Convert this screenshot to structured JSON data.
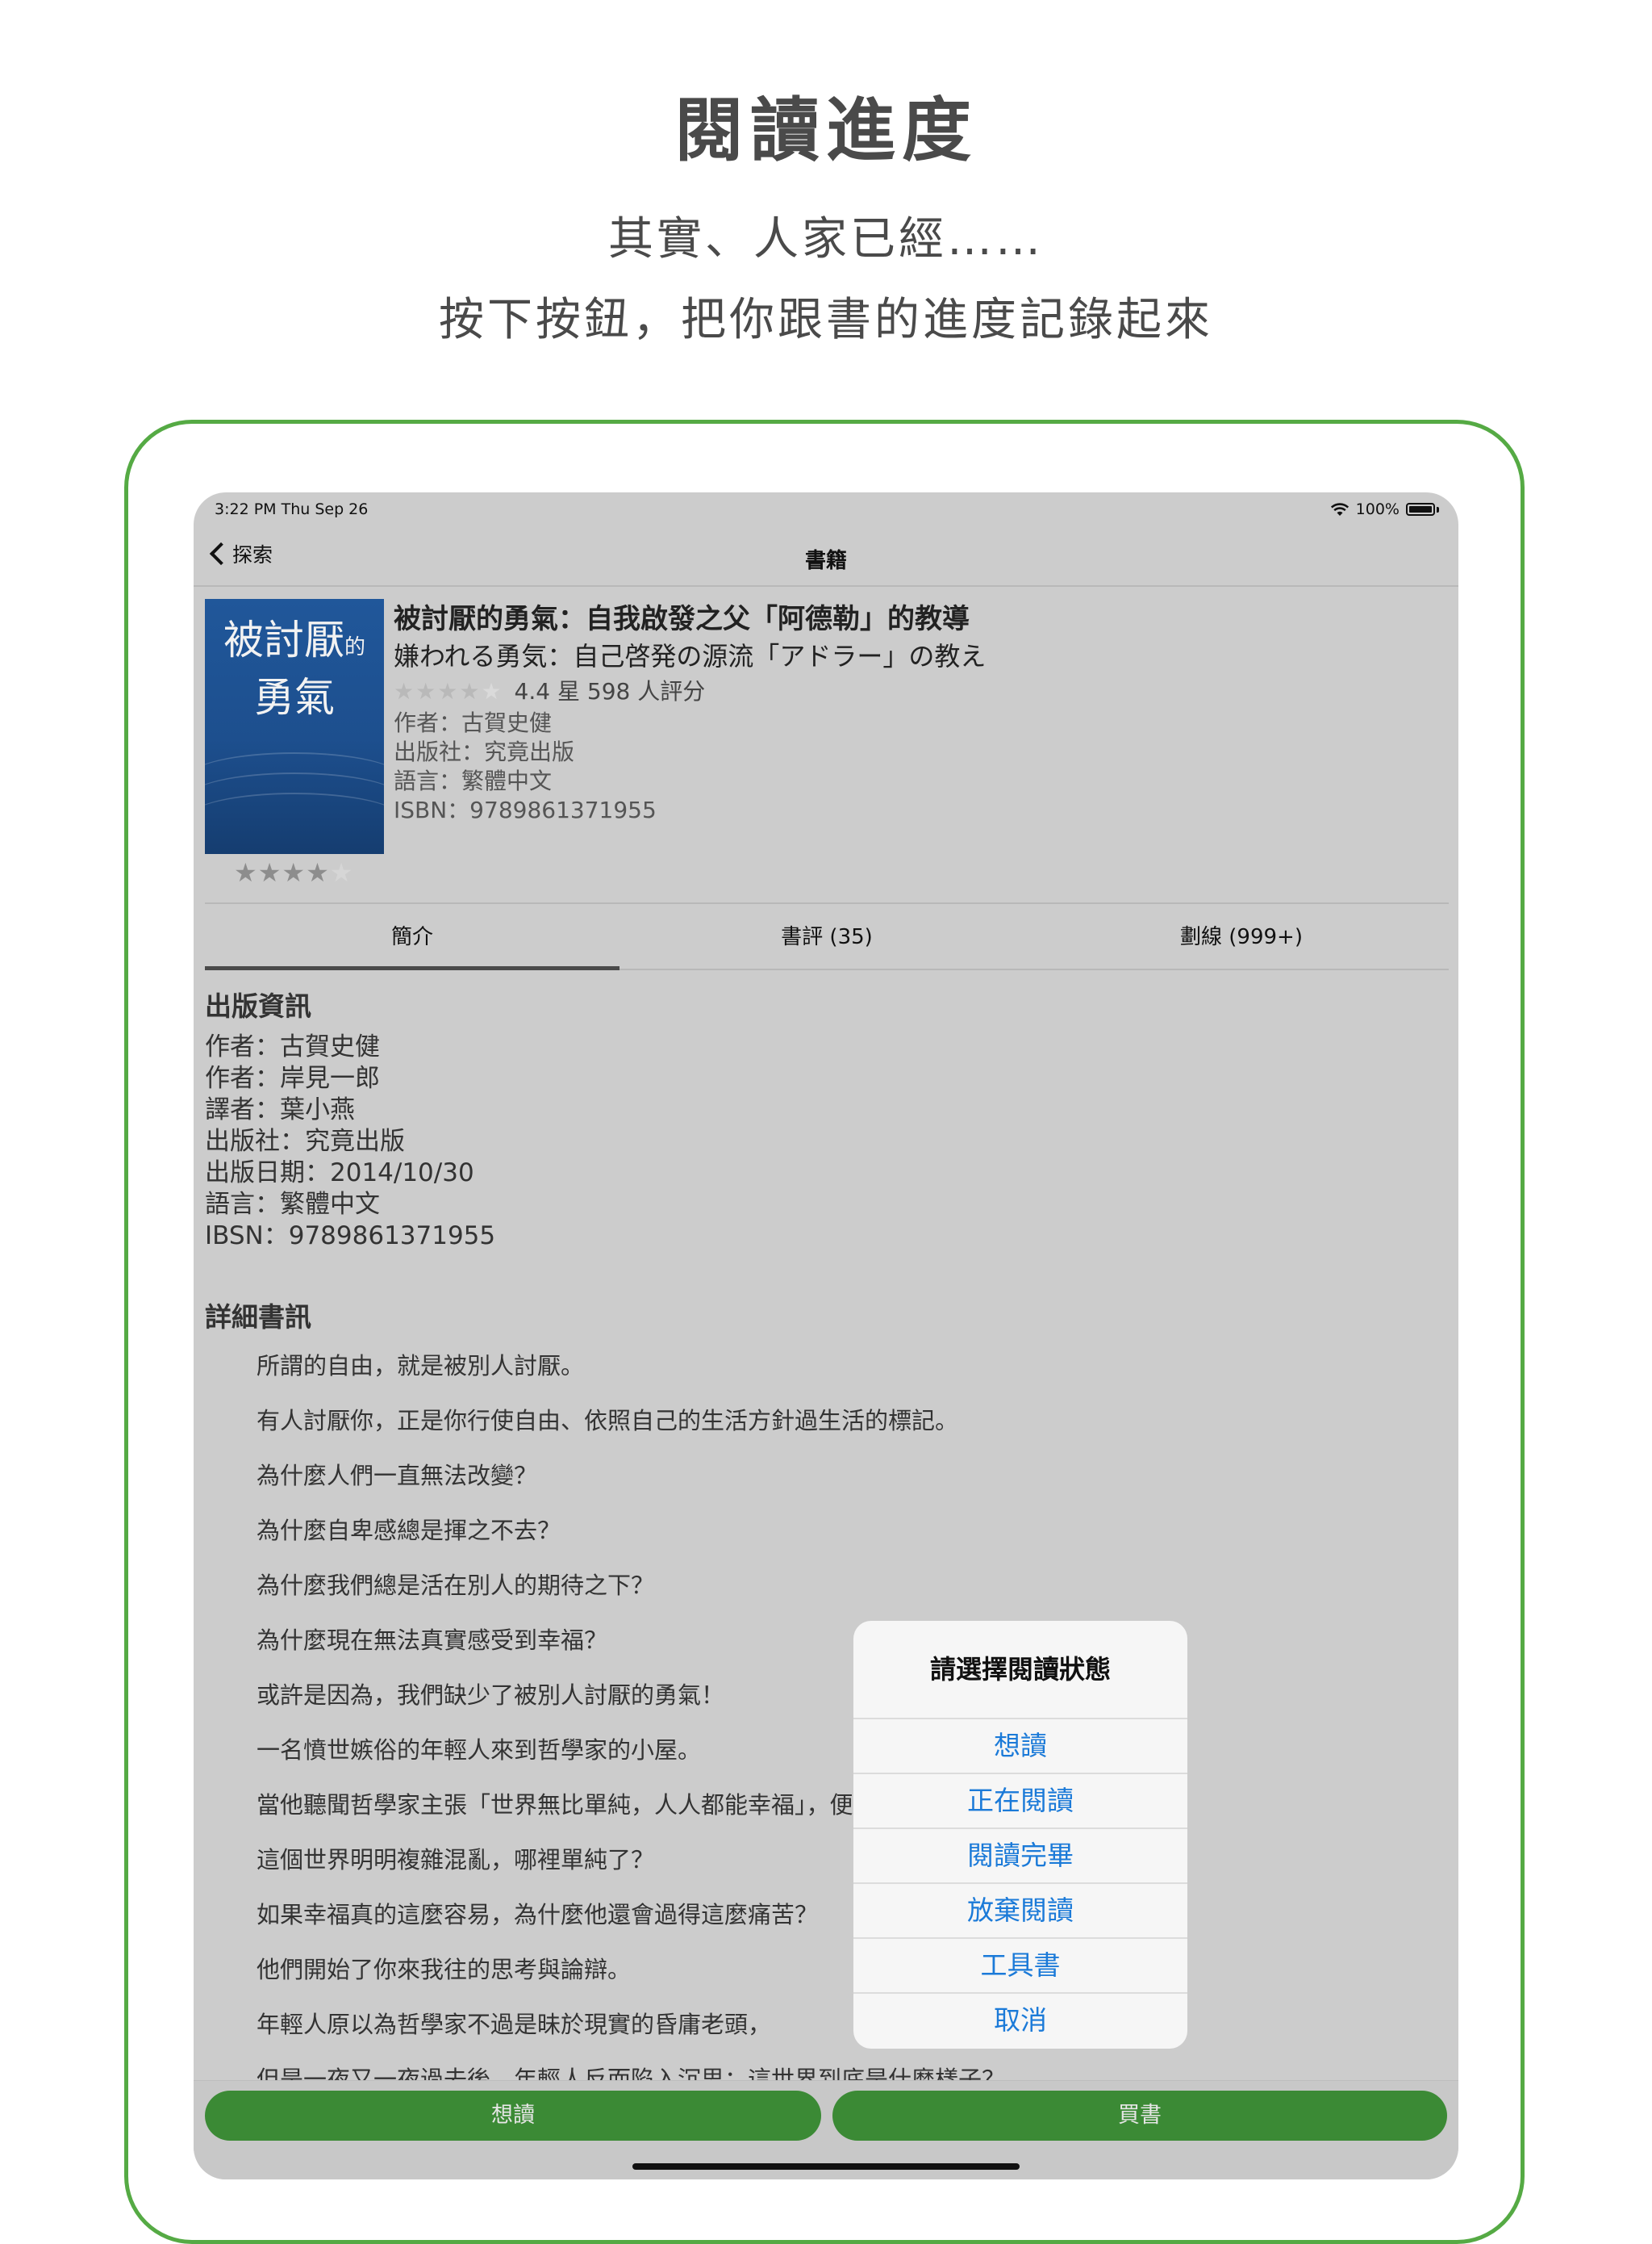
{
  "promo": {
    "title": "閱讀進度",
    "line1": "其實、人家已經……",
    "line2": "按下按鈕，把你跟書的進度記錄起來"
  },
  "status_bar": {
    "time": "3:22 PM   Thu Sep 26",
    "battery": "100%"
  },
  "nav": {
    "back_label": "探索",
    "title": "書籍"
  },
  "book": {
    "cover_title_line1": "被討厭",
    "cover_title_small": "的",
    "cover_title_line2": "勇氣",
    "cover_user_rating": 4,
    "title": "被討厭的勇氣：自我啟發之父「阿德勒」的教導",
    "original_title": "嫌われる勇気：自己啓発の源流「アドラー」の教え",
    "rating_text": "4.4 星 598 人評分",
    "rating_stars": 4,
    "author_line": "作者：古賀史健",
    "publisher_line": "出版社：究竟出版",
    "language_line": "語言：繁體中文",
    "isbn_line": "ISBN：9789861371955"
  },
  "tabs": [
    {
      "label": "簡介"
    },
    {
      "label": "書評 (35)"
    },
    {
      "label": "劃線 (999+)"
    }
  ],
  "publication": {
    "heading": "出版資訊",
    "lines": [
      "作者：古賀史健",
      "作者：岸見一郎",
      "譯者：葉小燕",
      "出版社：究竟出版",
      "出版日期：2014/10/30",
      "語言：繁體中文",
      "IBSN：9789861371955"
    ]
  },
  "detail": {
    "heading": "詳細書訊",
    "lines": [
      "所謂的自由，就是被別人討厭。",
      "有人討厭你，正是你行使自由、依照自己的生活方針過生活的標記。",
      "為什麼人們一直無法改變？",
      "為什麼自卑感總是揮之不去？",
      "為什麼我們總是活在別人的期待之下？",
      "為什麼現在無法真實感受到幸福？",
      "或許是因為，我們缺少了被別人討厭的勇氣！",
      "一名憤世嫉俗的年輕人來到哲學家的小屋。",
      "當他聽聞哲學家主張「世界無比單純，人人都能幸福」，便決心前來推翻這種謬論。",
      "這個世界明明複雜混亂，哪裡單純了？",
      "如果幸福真的這麼容易，為什麼他還會過得這麼痛苦？",
      "他們開始了你來我往的思考與論辯。",
      "年輕人原以為哲學家不過是昧於現實的昏庸老頭，",
      "但是一夜又一夜過去後，年輕人反而陷入沉思：這世界到底是什麼樣子？"
    ]
  },
  "bottom_bar": {
    "want_label": "想讀",
    "buy_label": "買書"
  },
  "alert": {
    "title": "請選擇閱讀狀態",
    "options": [
      "想讀",
      "正在閱讀",
      "閱讀完畢",
      "放棄閱讀",
      "工具書",
      "取消"
    ]
  },
  "colors": {
    "accent_green": "#3b8a35",
    "frame_green": "#55aa44",
    "alert_blue": "#1b7ad8",
    "dim_background": "#cccccc"
  },
  "icons": [
    "back-chevron-icon",
    "wifi-icon",
    "battery-icon",
    "star-icon"
  ]
}
